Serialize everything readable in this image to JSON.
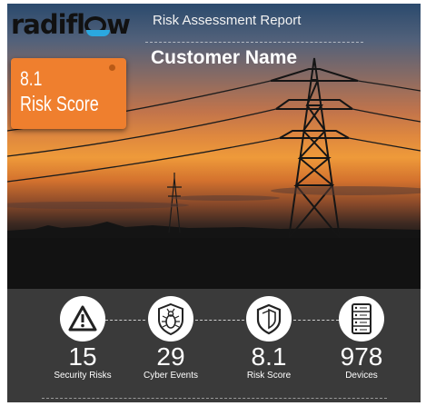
{
  "brand": {
    "name_before": "radifl",
    "name_after": "w",
    "tagline": ""
  },
  "header": {
    "report_title": "Risk Assessment Report",
    "customer_name": "Customer Name"
  },
  "badge": {
    "score": "8.1",
    "label": "Risk Score",
    "color": "#ef7f2e"
  },
  "stats": [
    {
      "value": "15",
      "label": "Security Risks",
      "icon": "warning-icon"
    },
    {
      "value": "29",
      "label": "Cyber Events",
      "icon": "bug-shield-icon"
    },
    {
      "value": "8.1",
      "label": "Risk Score",
      "icon": "shield-icon"
    },
    {
      "value": "978",
      "label": "Devices",
      "icon": "server-icon"
    }
  ]
}
